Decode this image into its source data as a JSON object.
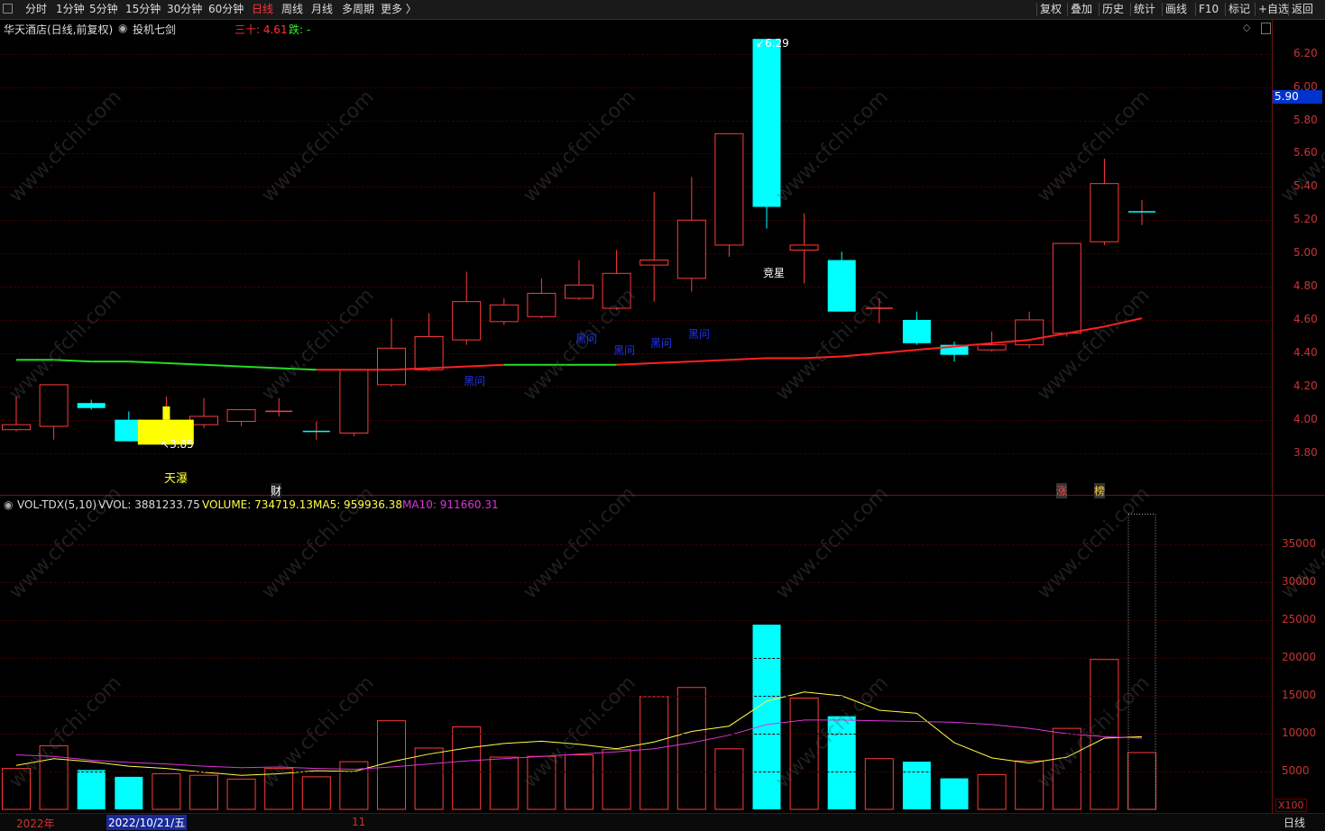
{
  "toolbar": {
    "periods": [
      "分时",
      "1分钟",
      "5分钟",
      "15分钟",
      "30分钟",
      "60分钟",
      "日线",
      "周线",
      "月线",
      "多周期",
      "更多 〉"
    ],
    "active": "日线",
    "right": [
      "复权",
      "叠加",
      "历史",
      "统计",
      "画线",
      "F10",
      "标记",
      "+自选",
      "返回"
    ]
  },
  "title": {
    "stock": "华天酒店(日线,前复权)",
    "indicator": "投机七剑",
    "ma_label": "三十: 4.61",
    "drop_label": "跌: -"
  },
  "price_axis": {
    "ticks": [
      "6.20",
      "6.00",
      "5.80",
      "5.60",
      "5.40",
      "5.20",
      "5.00",
      "4.80",
      "4.60",
      "4.40",
      "4.20",
      "4.00",
      "3.80"
    ],
    "current": "5.90",
    "high_label": "6.29",
    "low_label": "3.85"
  },
  "annotations": {
    "tianbao": "天瀑",
    "jingxing": "竞星",
    "hei_wen": "黑问",
    "cai": "财",
    "zhang": "涨",
    "bang": "榜"
  },
  "volume": {
    "title": "VOL-TDX(5,10)",
    "vvol": "VVOL: 3881233.75",
    "volume": "VOLUME: 734719.13",
    "ma5": "MA5: 959936.38",
    "ma10": "MA10: 911660.31",
    "ticks": [
      "35000",
      "30000",
      "25000",
      "20000",
      "15000",
      "10000",
      "5000"
    ],
    "unit": "X100"
  },
  "bottom": {
    "year": "2022年",
    "date": "2022/10/21/五",
    "month": "11",
    "period": "日线"
  },
  "colors": {
    "up": "#ff3b3b",
    "down": "#00ffff",
    "ma30_up": "#ff2020",
    "ma30_down": "#22dd22",
    "ma5": "#ffff44",
    "ma10": "#dd33dd"
  },
  "watermark": "www.cfchi.com",
  "candles": [
    {
      "o": 3.94,
      "h": 4.14,
      "l": 3.93,
      "c": 3.97,
      "v": 5400
    },
    {
      "o": 3.96,
      "h": 4.2,
      "l": 3.88,
      "c": 4.21,
      "v": 8400
    },
    {
      "o": 4.1,
      "h": 4.12,
      "l": 4.06,
      "c": 4.07,
      "v": 5200
    },
    {
      "o": 4.0,
      "h": 4.05,
      "l": 3.87,
      "c": 3.87,
      "v": 4300
    },
    {
      "o": 3.94,
      "h": 4.14,
      "l": 3.93,
      "c": 3.99,
      "v": 4700
    },
    {
      "o": 3.97,
      "h": 4.13,
      "l": 3.95,
      "c": 4.02,
      "v": 4500
    },
    {
      "o": 3.99,
      "h": 4.06,
      "l": 3.96,
      "c": 4.06,
      "v": 4000
    },
    {
      "o": 4.03,
      "h": 4.13,
      "l": 4.02,
      "c": 4.05,
      "v": 5400
    },
    {
      "o": 3.93,
      "h": 3.99,
      "l": 3.88,
      "c": 3.93,
      "v": 4300
    },
    {
      "o": 3.92,
      "h": 4.3,
      "l": 3.9,
      "c": 4.3,
      "v": 6300
    },
    {
      "o": 4.21,
      "h": 4.61,
      "l": 4.2,
      "c": 4.43,
      "v": 11700
    },
    {
      "o": 4.3,
      "h": 4.64,
      "l": 4.29,
      "c": 4.5,
      "v": 8100
    },
    {
      "o": 4.48,
      "h": 4.89,
      "l": 4.45,
      "c": 4.71,
      "v": 10900
    },
    {
      "o": 4.59,
      "h": 4.73,
      "l": 4.57,
      "c": 4.69,
      "v": 6900
    },
    {
      "o": 4.62,
      "h": 4.85,
      "l": 4.61,
      "c": 4.76,
      "v": 7000
    },
    {
      "o": 4.73,
      "h": 4.96,
      "l": 4.72,
      "c": 4.81,
      "v": 7200
    },
    {
      "o": 4.67,
      "h": 5.02,
      "l": 4.66,
      "c": 4.88,
      "v": 7900
    },
    {
      "o": 4.93,
      "h": 5.37,
      "l": 4.71,
      "c": 4.96,
      "v": 14900
    },
    {
      "o": 4.85,
      "h": 5.46,
      "l": 4.77,
      "c": 5.2,
      "v": 16100
    },
    {
      "o": 5.05,
      "h": 5.72,
      "l": 4.98,
      "c": 5.72,
      "v": 8000
    },
    {
      "o": 6.29,
      "h": 6.29,
      "l": 5.15,
      "c": 5.28,
      "v": 24400
    },
    {
      "o": 5.02,
      "h": 5.24,
      "l": 4.82,
      "c": 5.05,
      "v": 14700
    },
    {
      "o": 4.96,
      "h": 5.01,
      "l": 4.65,
      "c": 4.65,
      "v": 12300
    },
    {
      "o": 4.65,
      "h": 4.73,
      "l": 4.58,
      "c": 4.67,
      "v": 6700
    },
    {
      "o": 4.6,
      "h": 4.65,
      "l": 4.45,
      "c": 4.46,
      "v": 6300
    },
    {
      "o": 4.45,
      "h": 4.47,
      "l": 4.35,
      "c": 4.39,
      "v": 4100
    },
    {
      "o": 4.42,
      "h": 4.53,
      "l": 4.41,
      "c": 4.45,
      "v": 4600
    },
    {
      "o": 4.45,
      "h": 4.65,
      "l": 4.43,
      "c": 4.6,
      "v": 6400
    },
    {
      "o": 4.52,
      "h": 5.06,
      "l": 4.5,
      "c": 5.06,
      "v": 10700
    },
    {
      "o": 5.07,
      "h": 5.57,
      "l": 5.05,
      "c": 5.42,
      "v": 19800
    },
    {
      "o": 5.25,
      "h": 5.32,
      "l": 5.17,
      "c": 5.25,
      "v": 7500
    }
  ],
  "ma30": [
    4.36,
    4.36,
    4.35,
    4.35,
    4.34,
    4.33,
    4.32,
    4.31,
    4.3,
    4.3,
    4.3,
    4.31,
    4.32,
    4.33,
    4.33,
    4.33,
    4.33,
    4.34,
    4.35,
    4.36,
    4.37,
    4.37,
    4.38,
    4.4,
    4.42,
    4.44,
    4.46,
    4.48,
    4.52,
    4.56,
    4.61
  ],
  "ma30_colors": [
    "g",
    "g",
    "g",
    "g",
    "g",
    "g",
    "g",
    "g",
    "r",
    "r",
    "r",
    "r",
    "r",
    "g",
    "g",
    "g",
    "r",
    "r",
    "r",
    "r",
    "r",
    "r",
    "r",
    "r",
    "r",
    "r",
    "r",
    "r",
    "r",
    "r",
    "r"
  ],
  "vol_ma5": [
    5800,
    6700,
    6300,
    5700,
    5400,
    4900,
    4500,
    4700,
    5100,
    5000,
    6300,
    7300,
    8100,
    8700,
    9000,
    8600,
    8000,
    8900,
    10300,
    11000,
    14300,
    15500,
    15000,
    13100,
    12700,
    8800,
    6800,
    6100,
    6900,
    9400,
    9600
  ],
  "vol_ma10": [
    7200,
    7000,
    6500,
    6200,
    6000,
    5700,
    5500,
    5600,
    5400,
    5300,
    5600,
    6000,
    6400,
    6700,
    7000,
    7300,
    7600,
    8000,
    8800,
    9800,
    11200,
    11800,
    11800,
    11700,
    11600,
    11500,
    11200,
    10700,
    10000,
    9600,
    9400
  ]
}
